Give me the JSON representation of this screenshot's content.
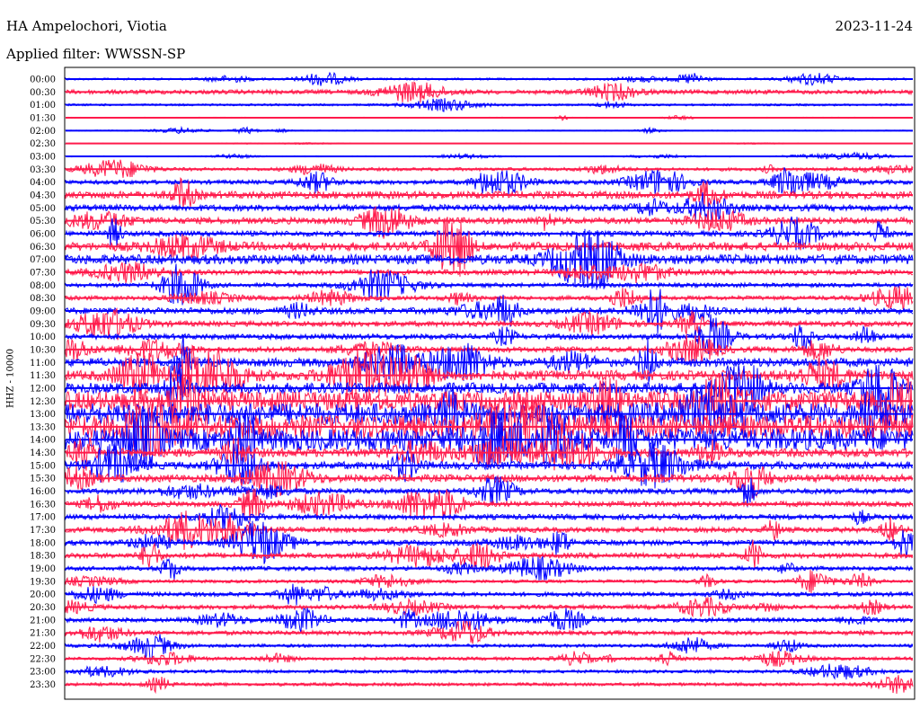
{
  "header": {
    "station": "HA Ampelochori, Viotia",
    "date": "2023-11-24",
    "filter": "Applied filter: WWSSN-SP"
  },
  "chart_data": {
    "type": "line",
    "title": "HA Ampelochori, Viotia",
    "ylabel": "HHZ - 10000",
    "xlabel": "",
    "row_labels": [
      "00:00",
      "00:30",
      "01:00",
      "01:30",
      "02:00",
      "02:30",
      "03:00",
      "03:30",
      "04:00",
      "04:30",
      "05:00",
      "05:30",
      "06:00",
      "06:30",
      "07:00",
      "07:30",
      "08:00",
      "08:30",
      "09:00",
      "09:30",
      "10:00",
      "10:30",
      "11:00",
      "11:30",
      "12:00",
      "12:30",
      "13:00",
      "13:30",
      "14:00",
      "14:30",
      "15:00",
      "15:30",
      "16:00",
      "16:30",
      "17:00",
      "17:30",
      "18:00",
      "18:30",
      "19:00",
      "19:30",
      "20:00",
      "20:30",
      "21:00",
      "21:30",
      "22:00",
      "22:30",
      "23:00",
      "23:30"
    ],
    "series_colors": [
      "#0000ff",
      "#ff1a4b"
    ],
    "noise_level": [
      2,
      4,
      2,
      1,
      1,
      0.5,
      1,
      3,
      4,
      7,
      6,
      6,
      5,
      8,
      9,
      5,
      4,
      4,
      6,
      5,
      5,
      5,
      8,
      9,
      10,
      18,
      20,
      22,
      20,
      8,
      7,
      7,
      5,
      5,
      5,
      5,
      5,
      5,
      4,
      3,
      4,
      4,
      4,
      4,
      3,
      3,
      3,
      3
    ],
    "grid": false
  }
}
